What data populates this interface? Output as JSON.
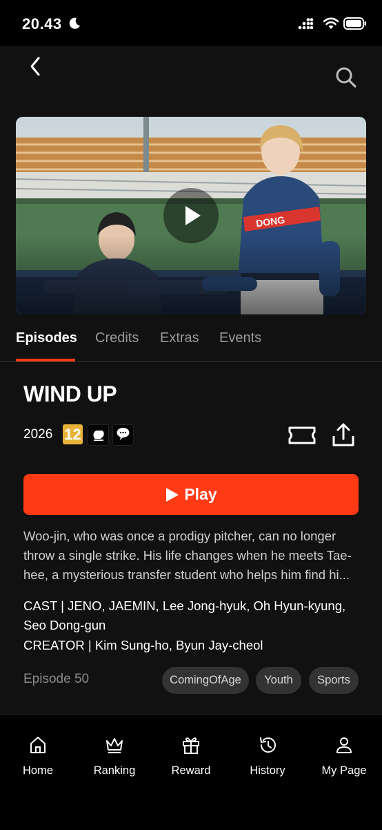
{
  "status": {
    "time": "20.43"
  },
  "tabs": [
    {
      "label": "Episodes",
      "active": true
    },
    {
      "label": "Credits"
    },
    {
      "label": "Extras"
    },
    {
      "label": "Events"
    }
  ],
  "show": {
    "title": "WIND UP",
    "year": "2026",
    "age_rating": "12",
    "play_label": "Play",
    "synopsis_lines": [
      "Woo-jin, who was once a prodigy pitcher, can no longer",
      "throw a single strike. His life changes when he meets Tae-",
      "hee, a mysterious transfer student who helps him find hi..."
    ],
    "cast_line1": "CAST  |  JENO, JAEMIN, Lee Jong-hyuk, Oh Hyun-kyung,",
    "cast_line2": "Seo Dong-gun",
    "creator_line": "CREATOR  |  Kim Sung-ho, Byun Jay-cheol",
    "episode_count": "Episode 50",
    "genres": [
      "ComingOfAge",
      "Youth",
      "Sports"
    ]
  },
  "nav": [
    {
      "label": "Home",
      "icon": "home-icon"
    },
    {
      "label": "Ranking",
      "icon": "crown-icon"
    },
    {
      "label": "Reward",
      "icon": "gift-icon"
    },
    {
      "label": "History",
      "icon": "history-icon"
    },
    {
      "label": "My Page",
      "icon": "person-icon"
    }
  ],
  "colors": {
    "accent": "#ff3a14",
    "background": "#111111",
    "age_badge": "#e8b23a"
  }
}
